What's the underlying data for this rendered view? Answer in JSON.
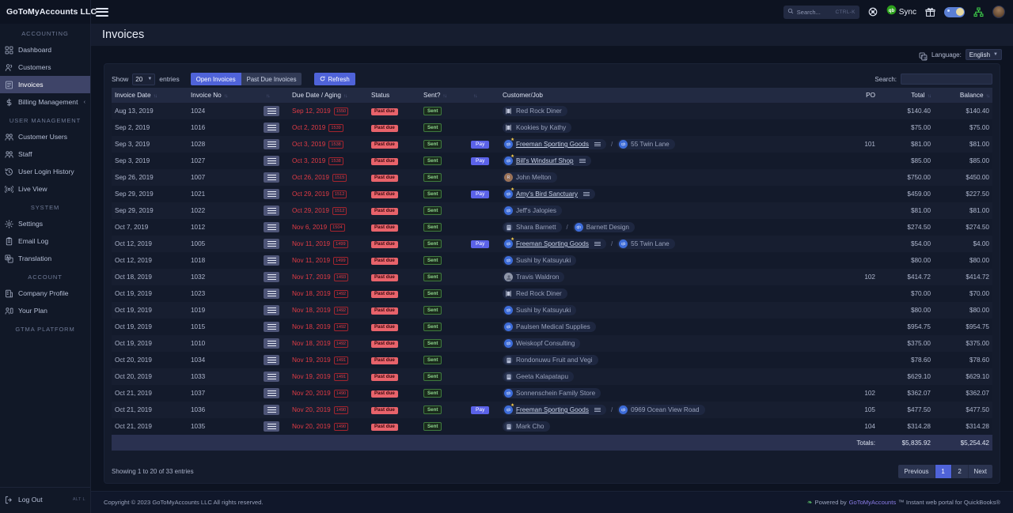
{
  "brand": {
    "name": "GoToMyAccounts LLC"
  },
  "sidebar": {
    "sections": [
      {
        "label": "ACCOUNTING",
        "items": [
          {
            "label": "Dashboard",
            "icon": "dashboard-icon",
            "active": false
          },
          {
            "label": "Customers",
            "icon": "customers-icon",
            "active": false
          },
          {
            "label": "Invoices",
            "icon": "invoices-icon",
            "active": true
          },
          {
            "label": "Billing Management",
            "icon": "dollar-icon",
            "active": false,
            "chevron": "‹"
          }
        ]
      },
      {
        "label": "USER MANAGEMENT",
        "items": [
          {
            "label": "Customer Users",
            "icon": "users-icon",
            "active": false
          },
          {
            "label": "Staff",
            "icon": "users-icon",
            "active": false
          },
          {
            "label": "User Login History",
            "icon": "history-icon",
            "active": false
          },
          {
            "label": "Live View",
            "icon": "broadcast-icon",
            "active": false
          }
        ]
      },
      {
        "label": "SYSTEM",
        "items": [
          {
            "label": "Settings",
            "icon": "gear-icon",
            "active": false
          },
          {
            "label": "Email Log",
            "icon": "clipboard-icon",
            "active": false
          },
          {
            "label": "Translation",
            "icon": "translate-icon",
            "active": false
          }
        ]
      },
      {
        "label": "ACCOUNT",
        "items": [
          {
            "label": "Company Profile",
            "icon": "building-icon",
            "active": false
          },
          {
            "label": "Your Plan",
            "icon": "plan-icon",
            "active": false
          }
        ]
      },
      {
        "label": "GTMA PLATFORM",
        "items": []
      }
    ],
    "logout": {
      "label": "Log Out",
      "shortcut": "ALT L",
      "icon": "logout-icon"
    }
  },
  "topbar": {
    "search": {
      "placeholder": "Search...",
      "shortcut": "CTRL-K",
      "icon": "search-icon"
    },
    "help_icon": "lifebuoy-icon",
    "sync": {
      "label": "Sync",
      "icon": "quickbooks-icon"
    },
    "gift_icon": "gift-icon",
    "theme_toggle_icon": "dark-mode-toggle",
    "sitemap_icon": "sitemap-icon",
    "avatar": "user-avatar"
  },
  "page": {
    "title": "Invoices",
    "language": {
      "label": "Language:",
      "value": "English",
      "icon": "translate-icon"
    }
  },
  "toolbar": {
    "show_label": "Show",
    "entries_value": "20",
    "entries_label": "entries",
    "tab_open": "Open Invoices",
    "tab_pastdue": "Past Due Invoices",
    "refresh_label": "Refresh",
    "search_label": "Search:",
    "search_value": ""
  },
  "table": {
    "columns": [
      "Invoice Date",
      "Invoice No",
      "",
      "Due Date / Aging",
      "Status",
      "Sent?",
      "",
      "Customer/Job",
      "PO",
      "Total",
      "Balance"
    ],
    "rows": [
      {
        "date": "Aug 13, 2019",
        "no": "1024",
        "due": "Sep 12, 2019",
        "aging": "1550",
        "status": "Past due",
        "sent": "Sent",
        "pay": false,
        "customer": {
          "name": "Red Rock Diner",
          "avatar": "qb",
          "link": false,
          "star": false,
          "lines": false
        },
        "job": null,
        "po": "",
        "total": "$140.40",
        "balance": "$140.40"
      },
      {
        "date": "Sep 2, 2019",
        "no": "1016",
        "due": "Oct 2, 2019",
        "aging": "1539",
        "status": "Past due",
        "sent": "Sent",
        "pay": false,
        "customer": {
          "name": "Kookies by Kathy",
          "avatar": "qb",
          "link": false,
          "star": false,
          "lines": false
        },
        "job": null,
        "po": "",
        "total": "$75.00",
        "balance": "$75.00"
      },
      {
        "date": "Sep 3, 2019",
        "no": "1028",
        "due": "Oct 3, 2019",
        "aging": "1538",
        "status": "Past due",
        "sent": "Sent",
        "pay": true,
        "customer": {
          "name": "Freeman Sporting Goods",
          "avatar": "blue",
          "link": true,
          "star": true,
          "lines": true
        },
        "job": {
          "name": "55 Twin Lane",
          "avatar": "blue"
        },
        "po": "101",
        "total": "$81.00",
        "balance": "$81.00"
      },
      {
        "date": "Sep 3, 2019",
        "no": "1027",
        "due": "Oct 3, 2019",
        "aging": "1538",
        "status": "Past due",
        "sent": "Sent",
        "pay": true,
        "customer": {
          "name": "Bill's Windsurf Shop",
          "avatar": "blue",
          "link": true,
          "star": true,
          "lines": true
        },
        "job": null,
        "po": "",
        "total": "$85.00",
        "balance": "$85.00"
      },
      {
        "date": "Sep 26, 2019",
        "no": "1007",
        "due": "Oct 26, 2019",
        "aging": "1515",
        "status": "Past due",
        "sent": "Sent",
        "pay": false,
        "customer": {
          "name": "John Melton",
          "avatar": "brown",
          "link": false,
          "star": false,
          "lines": false
        },
        "job": null,
        "po": "",
        "total": "$750.00",
        "balance": "$450.00"
      },
      {
        "date": "Sep 29, 2019",
        "no": "1021",
        "due": "Oct 29, 2019",
        "aging": "1512",
        "status": "Past due",
        "sent": "Sent",
        "pay": true,
        "customer": {
          "name": "Amy's Bird Sanctuary",
          "avatar": "blue",
          "link": true,
          "star": true,
          "lines": true
        },
        "job": null,
        "po": "",
        "total": "$459.00",
        "balance": "$227.50"
      },
      {
        "date": "Sep 29, 2019",
        "no": "1022",
        "due": "Oct 29, 2019",
        "aging": "1512",
        "status": "Past due",
        "sent": "Sent",
        "pay": false,
        "customer": {
          "name": "Jeff's Jalopies",
          "avatar": "blue",
          "link": false,
          "star": false,
          "lines": false
        },
        "job": null,
        "po": "",
        "total": "$81.00",
        "balance": "$81.00"
      },
      {
        "date": "Oct 7, 2019",
        "no": "1012",
        "due": "Nov 6, 2019",
        "aging": "1504",
        "status": "Past due",
        "sent": "Sent",
        "pay": false,
        "customer": {
          "name": "Shara Barnett",
          "avatar": "bld",
          "link": false,
          "star": false,
          "lines": false
        },
        "job": {
          "name": "Barnett Design",
          "avatar": "blue"
        },
        "po": "",
        "total": "$274.50",
        "balance": "$274.50"
      },
      {
        "date": "Oct 12, 2019",
        "no": "1005",
        "due": "Nov 11, 2019",
        "aging": "1499",
        "status": "Past due",
        "sent": "Sent",
        "pay": true,
        "customer": {
          "name": "Freeman Sporting Goods",
          "avatar": "blue",
          "link": true,
          "star": true,
          "lines": true
        },
        "job": {
          "name": "55 Twin Lane",
          "avatar": "blue"
        },
        "po": "",
        "total": "$54.00",
        "balance": "$4.00"
      },
      {
        "date": "Oct 12, 2019",
        "no": "1018",
        "due": "Nov 11, 2019",
        "aging": "1499",
        "status": "Past due",
        "sent": "Sent",
        "pay": false,
        "customer": {
          "name": "Sushi by Katsuyuki",
          "avatar": "blue",
          "link": false,
          "star": false,
          "lines": false
        },
        "job": null,
        "po": "",
        "total": "$80.00",
        "balance": "$80.00"
      },
      {
        "date": "Oct 18, 2019",
        "no": "1032",
        "due": "Nov 17, 2019",
        "aging": "1493",
        "status": "Past due",
        "sent": "Sent",
        "pay": false,
        "customer": {
          "name": "Travis Waldron",
          "avatar": "grey",
          "link": false,
          "star": false,
          "lines": false
        },
        "job": null,
        "po": "102",
        "total": "$414.72",
        "balance": "$414.72"
      },
      {
        "date": "Oct 19, 2019",
        "no": "1023",
        "due": "Nov 18, 2019",
        "aging": "1492",
        "status": "Past due",
        "sent": "Sent",
        "pay": false,
        "customer": {
          "name": "Red Rock Diner",
          "avatar": "qb",
          "link": false,
          "star": false,
          "lines": false
        },
        "job": null,
        "po": "",
        "total": "$70.00",
        "balance": "$70.00"
      },
      {
        "date": "Oct 19, 2019",
        "no": "1019",
        "due": "Nov 18, 2019",
        "aging": "1492",
        "status": "Past due",
        "sent": "Sent",
        "pay": false,
        "customer": {
          "name": "Sushi by Katsuyuki",
          "avatar": "blue",
          "link": false,
          "star": false,
          "lines": false
        },
        "job": null,
        "po": "",
        "total": "$80.00",
        "balance": "$80.00"
      },
      {
        "date": "Oct 19, 2019",
        "no": "1015",
        "due": "Nov 18, 2019",
        "aging": "1492",
        "status": "Past due",
        "sent": "Sent",
        "pay": false,
        "customer": {
          "name": "Paulsen Medical Supplies",
          "avatar": "blue",
          "link": false,
          "star": false,
          "lines": false
        },
        "job": null,
        "po": "",
        "total": "$954.75",
        "balance": "$954.75"
      },
      {
        "date": "Oct 19, 2019",
        "no": "1010",
        "due": "Nov 18, 2019",
        "aging": "1492",
        "status": "Past due",
        "sent": "Sent",
        "pay": false,
        "customer": {
          "name": "Weiskopf Consulting",
          "avatar": "blue",
          "link": false,
          "star": false,
          "lines": false
        },
        "job": null,
        "po": "",
        "total": "$375.00",
        "balance": "$375.00"
      },
      {
        "date": "Oct 20, 2019",
        "no": "1034",
        "due": "Nov 19, 2019",
        "aging": "1491",
        "status": "Past due",
        "sent": "Sent",
        "pay": false,
        "customer": {
          "name": "Rondonuwu Fruit and Vegi",
          "avatar": "bld",
          "link": false,
          "star": false,
          "lines": false
        },
        "job": null,
        "po": "",
        "total": "$78.60",
        "balance": "$78.60"
      },
      {
        "date": "Oct 20, 2019",
        "no": "1033",
        "due": "Nov 19, 2019",
        "aging": "1491",
        "status": "Past due",
        "sent": "Sent",
        "pay": false,
        "customer": {
          "name": "Geeta Kalapatapu",
          "avatar": "bld",
          "link": false,
          "star": false,
          "lines": false
        },
        "job": null,
        "po": "",
        "total": "$629.10",
        "balance": "$629.10"
      },
      {
        "date": "Oct 21, 2019",
        "no": "1037",
        "due": "Nov 20, 2019",
        "aging": "1490",
        "status": "Past due",
        "sent": "Sent",
        "pay": false,
        "customer": {
          "name": "Sonnenschein Family Store",
          "avatar": "blue",
          "link": false,
          "star": false,
          "lines": false
        },
        "job": null,
        "po": "102",
        "total": "$362.07",
        "balance": "$362.07"
      },
      {
        "date": "Oct 21, 2019",
        "no": "1036",
        "due": "Nov 20, 2019",
        "aging": "1490",
        "status": "Past due",
        "sent": "Sent",
        "pay": true,
        "customer": {
          "name": "Freeman Sporting Goods",
          "avatar": "blue",
          "link": true,
          "star": true,
          "lines": true
        },
        "job": {
          "name": "0969 Ocean View Road",
          "avatar": "blue"
        },
        "po": "105",
        "total": "$477.50",
        "balance": "$477.50"
      },
      {
        "date": "Oct 21, 2019",
        "no": "1035",
        "due": "Nov 20, 2019",
        "aging": "1490",
        "status": "Past due",
        "sent": "Sent",
        "pay": false,
        "customer": {
          "name": "Mark Cho",
          "avatar": "bld",
          "link": false,
          "star": false,
          "lines": false
        },
        "job": null,
        "po": "104",
        "total": "$314.28",
        "balance": "$314.28"
      }
    ],
    "totals": {
      "label": "Totals:",
      "total": "$5,835.92",
      "balance": "$5,254.42"
    }
  },
  "pagination": {
    "showing": "Showing 1 to 20 of 33 entries",
    "previous": "Previous",
    "pages": [
      "1",
      "2"
    ],
    "active_page": "1",
    "next": "Next"
  },
  "footer": {
    "copyright": "Copyright © 2023 GoToMyAccounts LLC All rights reserved.",
    "powered_prefix": "Powered by",
    "powered_brand": "GoToMyAccounts",
    "powered_suffix": "™ Instant web portal for QuickBooks®"
  },
  "colors": {
    "accent": "#4f63d9",
    "danger": "#e03b45",
    "success": "#5ac16a",
    "sidebar_bg": "#111827",
    "page_bg": "#0d1321"
  }
}
